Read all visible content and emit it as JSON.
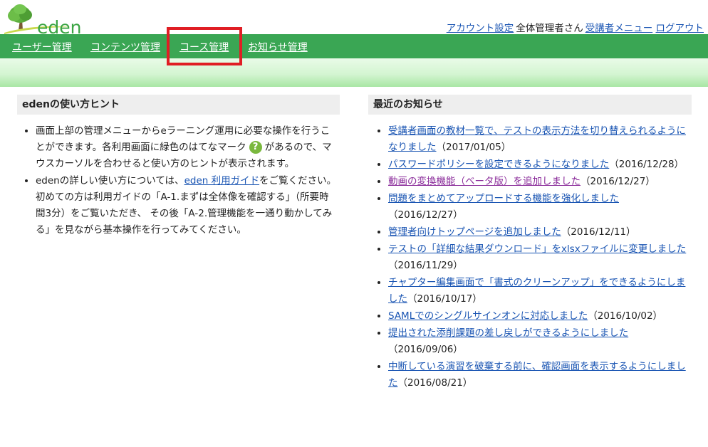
{
  "header": {
    "logo_text": "eden",
    "account_settings": "アカウント設定",
    "user_name": "全体管理者さん",
    "student_menu": "受講者メニュー",
    "logout": "ログアウト"
  },
  "nav": {
    "items": [
      "ユーザー管理",
      "コンテンツ管理",
      "コース管理",
      "お知らせ管理"
    ]
  },
  "hints": {
    "title": "edenの使い方ヒント",
    "item1_a": "画面上部の管理メニューからeラーニング運用に必要な操作を行うことができます。各利用画面に緑色のはてなマーク",
    "item1_icon": "?",
    "item1_b": "があるので、マウスカーソルを合わせると使い方のヒントが表示されます。",
    "item2_a": "edenの詳しい使い方については、",
    "item2_link": "eden 利用ガイド",
    "item2_b": "をご覧ください。初めての方は利用ガイドの「A-1.まずは全体像を確認する」（所要時間3分）をご覧いただき、 その後「A-2.管理機能を一通り動かしてみる」を見ながら基本操作を行ってみてください。"
  },
  "news": {
    "title": "最近のお知らせ",
    "items": [
      {
        "text": "受講者画面の教材一覧で、テストの表示方法を切り替えられるようになりました",
        "date": "（2017/01/05）"
      },
      {
        "text": "パスワードポリシーを設定できるようになりました",
        "date": "（2016/12/28）"
      },
      {
        "text": "動画の変換機能（ベータ版）を追加しました",
        "date": "（2016/12/27）"
      },
      {
        "text": "問題をまとめてアップロードする機能を強化しました",
        "date": "（2016/12/27）"
      },
      {
        "text": "管理者向けトップページを追加しました",
        "date": "（2016/12/11）"
      },
      {
        "text": "テストの「詳細な結果ダウンロード」をxlsxファイルに変更しました",
        "date": "（2016/11/29）"
      },
      {
        "text": "チャプター編集画面で「書式のクリーンアップ」をできるようにしました",
        "date": "（2016/10/17）"
      },
      {
        "text": "SAMLでのシングルサインオンに対応しました",
        "date": "（2016/10/02）"
      },
      {
        "text": "提出された添削課題の差し戻しができるようにしました",
        "date": "（2016/09/06）"
      },
      {
        "text": "中断している演習を破棄する前に、確認画面を表示するようにしました",
        "date": "（2016/08/21）"
      }
    ]
  },
  "colors": {
    "nav_green": "#3aa654",
    "highlight_red": "#e01e24",
    "link_blue": "#1a55b3",
    "visited_purple": "#8a2b9a"
  }
}
